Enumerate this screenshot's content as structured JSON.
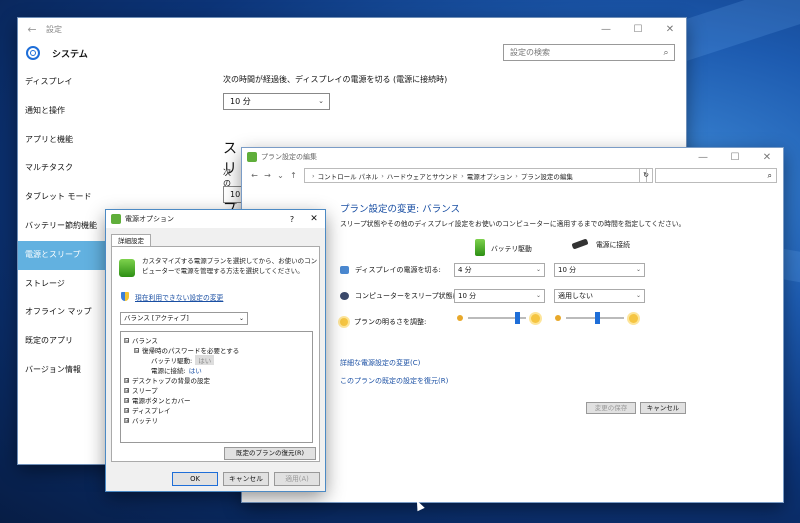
{
  "settings": {
    "window_title": "設定",
    "back_icon": "back-arrow-icon",
    "app_title": "システム",
    "search_placeholder": "設定の検索",
    "sidebar": [
      {
        "label": "ディスプレイ"
      },
      {
        "label": "通知と操作"
      },
      {
        "label": "アプリと機能"
      },
      {
        "label": "マルチタスク"
      },
      {
        "label": "タブレット モード"
      },
      {
        "label": "バッテリー節約機能"
      },
      {
        "label": "電源とスリープ",
        "selected": true
      },
      {
        "label": "ストレージ"
      },
      {
        "label": "オフライン マップ"
      },
      {
        "label": "既定のアプリ"
      },
      {
        "label": "バージョン情報"
      }
    ],
    "screen_off_label": "次の時間が経過後、ディスプレイの電源を切る (電源に接続時)",
    "screen_off_value": "10 分",
    "sleep_heading": "スリープ",
    "sleep_label": "次の",
    "sleep_value": "10"
  },
  "plan_window": {
    "title": "プラン設定の編集",
    "breadcrumb": [
      "コントロール パネル",
      "ハードウェアとサウンド",
      "電源オプション",
      "プラン設定の編集"
    ],
    "heading": "プラン設定の変更: バランス",
    "subtitle": "スリープ状態やその他のディスプレイ設定をお使いのコンピューターに適用するまでの時間を指定してください。",
    "col_battery": "バッテリ駆動",
    "col_plugged": "電源に接続",
    "display_off_label": "ディスプレイの電源を切る:",
    "display_off_battery": "4 分",
    "display_off_plugged": "10 分",
    "sleep_label": "コンピューターをスリープ状態にする:",
    "sleep_battery": "10 分",
    "sleep_plugged": "適用しない",
    "brightness_label": "プランの明るさを調整:",
    "brightness_battery": 0.88,
    "brightness_plugged": 0.55,
    "link_advanced": "詳細な電源設定の変更(C)",
    "link_restore": "このプランの既定の設定を復元(R)",
    "save_button": "変更の保存",
    "cancel_button": "キャンセル"
  },
  "power_dialog": {
    "title": "電源オプション",
    "help_label": "?",
    "tab": "詳細設定",
    "description": "カスタマイズする電源プランを選択してから、お使いのコンピューターで電源を管理する方法を選択してください。",
    "unavailable_link": "現在利用できない設定の変更",
    "selected_plan": "バランス [アクティブ]",
    "tree": [
      {
        "label": "バランス",
        "toggle": "⊟",
        "level": 0
      },
      {
        "label": "復帰時のパスワードを必要とする",
        "toggle": "⊟",
        "level": 1
      },
      {
        "label": "バッテリ駆動:",
        "value": "はい",
        "level": 2,
        "disabled": true
      },
      {
        "label": "電源に接続:",
        "value": "はい",
        "level": 2,
        "link": true
      },
      {
        "label": "デスクトップの背景の設定",
        "toggle": "⊞",
        "level": 1
      },
      {
        "label": "スリープ",
        "toggle": "⊞",
        "level": 1
      },
      {
        "label": "電源ボタンとカバー",
        "toggle": "⊞",
        "level": 1
      },
      {
        "label": "ディスプレイ",
        "toggle": "⊞",
        "level": 1
      },
      {
        "label": "バッテリ",
        "toggle": "⊞",
        "level": 1
      }
    ],
    "restore_button": "既定のプランの復元(R)",
    "ok_button": "OK",
    "cancel_button": "キャンセル",
    "apply_button": "適用(A)"
  }
}
